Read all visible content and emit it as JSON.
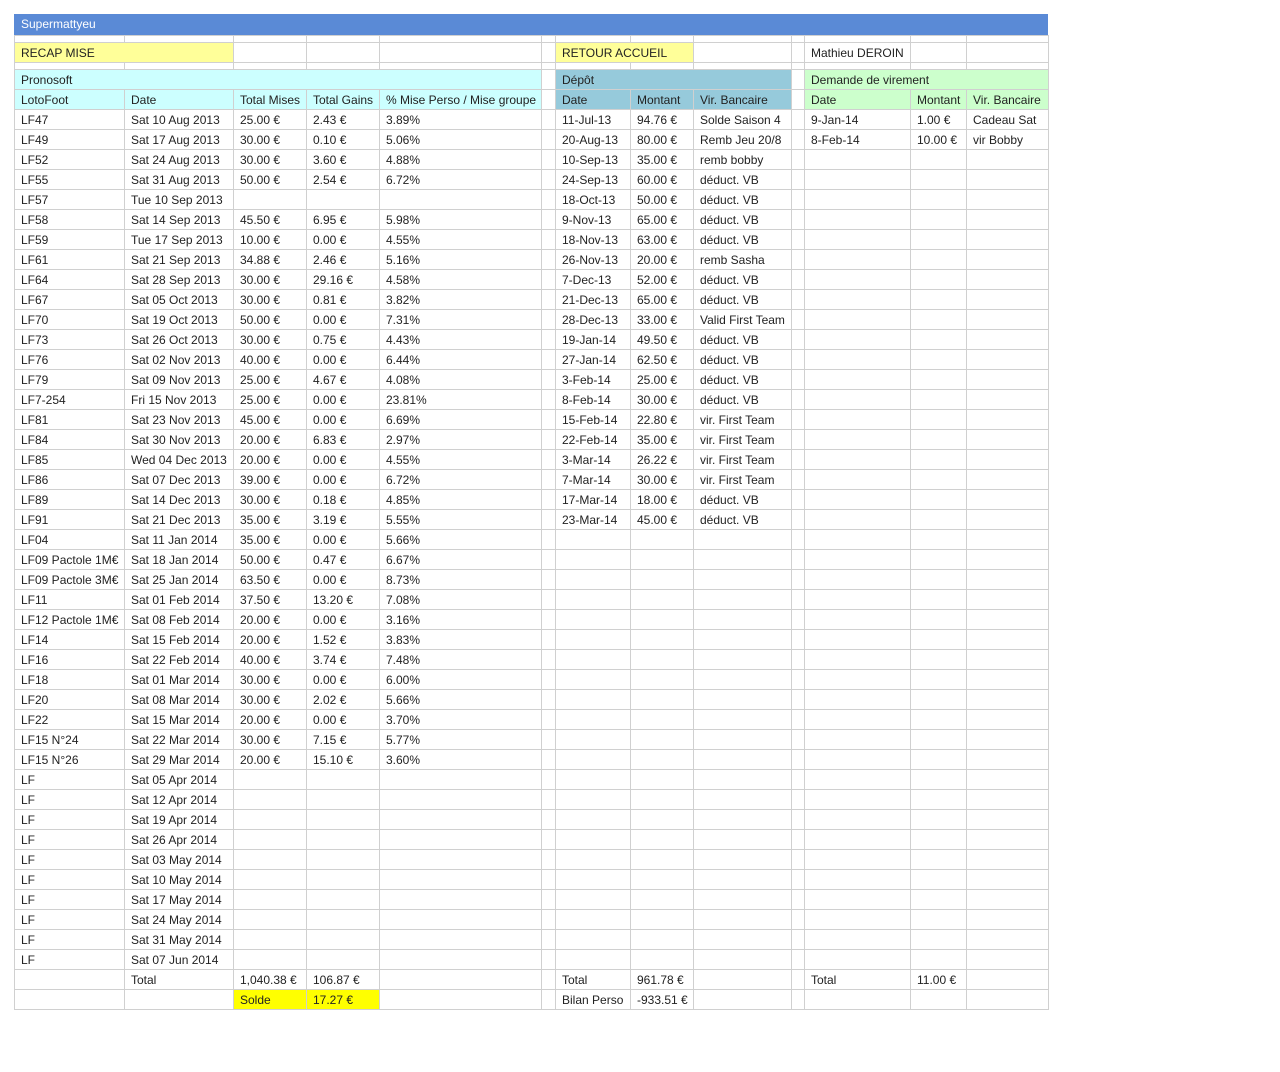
{
  "sheet_title": "Supermattyeu",
  "top": {
    "recap_button": "RECAP MISE",
    "home_button": "RETOUR ACCUEIL",
    "user_name": "Mathieu DEROIN"
  },
  "sections": {
    "pronosoft": "Pronosoft",
    "depot": "Dépôt",
    "virement": "Demande de virement"
  },
  "colors": {
    "title_bar": "#5a8ad6",
    "yellow_cell": "#ffff99",
    "cyan_header": "#ccffff",
    "blue_header": "#96cadb",
    "green_header": "#ccffcc",
    "highlight": "#ffff00"
  },
  "headers": {
    "lotofoot": "LotoFoot",
    "date": "Date",
    "total_mises": "Total Mises",
    "total_gains": "Total Gains",
    "pct": "% Mise Perso / Mise groupe",
    "dep_date": "Date",
    "dep_montant": "Montant",
    "dep_vir": "Vir. Bancaire",
    "vir_date": "Date",
    "vir_montant": "Montant",
    "vir_vir": "Vir. Bancaire"
  },
  "pronos": [
    {
      "lf": "LF47",
      "date": "Sat 10 Aug 2013",
      "mises": "25.00 €",
      "gains": "2.43 €",
      "pct": "3.89%"
    },
    {
      "lf": "LF49",
      "date": "Sat 17 Aug 2013",
      "mises": "30.00 €",
      "gains": "0.10 €",
      "pct": "5.06%"
    },
    {
      "lf": "LF52",
      "date": "Sat 24 Aug 2013",
      "mises": "30.00 €",
      "gains": "3.60 €",
      "pct": "4.88%"
    },
    {
      "lf": "LF55",
      "date": "Sat 31 Aug 2013",
      "mises": "50.00 €",
      "gains": "2.54 €",
      "pct": "6.72%"
    },
    {
      "lf": "LF57",
      "date": "Tue 10 Sep 2013",
      "mises": "",
      "gains": "",
      "pct": ""
    },
    {
      "lf": "LF58",
      "date": "Sat 14 Sep 2013",
      "mises": "45.50 €",
      "gains": "6.95 €",
      "pct": "5.98%"
    },
    {
      "lf": "LF59",
      "date": "Tue 17 Sep 2013",
      "mises": "10.00 €",
      "gains": "0.00 €",
      "pct": "4.55%"
    },
    {
      "lf": "LF61",
      "date": "Sat 21 Sep 2013",
      "mises": "34.88 €",
      "gains": "2.46 €",
      "pct": "5.16%"
    },
    {
      "lf": "LF64",
      "date": "Sat 28 Sep 2013",
      "mises": "30.00 €",
      "gains": "29.16 €",
      "pct": "4.58%"
    },
    {
      "lf": "LF67",
      "date": "Sat 05 Oct 2013",
      "mises": "30.00 €",
      "gains": "0.81 €",
      "pct": "3.82%"
    },
    {
      "lf": "LF70",
      "date": "Sat 19 Oct 2013",
      "mises": "50.00 €",
      "gains": "0.00 €",
      "pct": "7.31%"
    },
    {
      "lf": "LF73",
      "date": "Sat 26 Oct 2013",
      "mises": "30.00 €",
      "gains": "0.75 €",
      "pct": "4.43%"
    },
    {
      "lf": "LF76",
      "date": "Sat 02 Nov 2013",
      "mises": "40.00 €",
      "gains": "0.00 €",
      "pct": "6.44%"
    },
    {
      "lf": "LF79",
      "date": "Sat 09 Nov 2013",
      "mises": "25.00 €",
      "gains": "4.67 €",
      "pct": "4.08%"
    },
    {
      "lf": "LF7-254",
      "date": "Fri 15 Nov 2013",
      "mises": "25.00 €",
      "gains": "0.00 €",
      "pct": "23.81%"
    },
    {
      "lf": "LF81",
      "date": "Sat 23 Nov 2013",
      "mises": "45.00 €",
      "gains": "0.00 €",
      "pct": "6.69%"
    },
    {
      "lf": "LF84",
      "date": "Sat 30 Nov 2013",
      "mises": "20.00 €",
      "gains": "6.83 €",
      "pct": "2.97%"
    },
    {
      "lf": "LF85",
      "date": "Wed 04 Dec 2013",
      "mises": "20.00 €",
      "gains": "0.00 €",
      "pct": "4.55%"
    },
    {
      "lf": "LF86",
      "date": "Sat 07 Dec 2013",
      "mises": "39.00 €",
      "gains": "0.00 €",
      "pct": "6.72%"
    },
    {
      "lf": "LF89",
      "date": "Sat 14 Dec 2013",
      "mises": "30.00 €",
      "gains": "0.18 €",
      "pct": "4.85%"
    },
    {
      "lf": "LF91",
      "date": "Sat 21 Dec 2013",
      "mises": "35.00 €",
      "gains": "3.19 €",
      "pct": "5.55%"
    },
    {
      "lf": "LF04",
      "date": "Sat 11 Jan 2014",
      "mises": "35.00 €",
      "gains": "0.00 €",
      "pct": "5.66%"
    },
    {
      "lf": "LF09 Pactole 1M€",
      "date": "Sat 18 Jan 2014",
      "mises": "50.00 €",
      "gains": "0.47 €",
      "pct": "6.67%"
    },
    {
      "lf": "LF09 Pactole 3M€",
      "date": "Sat 25 Jan 2014",
      "mises": "63.50 €",
      "gains": "0.00 €",
      "pct": "8.73%"
    },
    {
      "lf": "LF11",
      "date": "Sat 01 Feb 2014",
      "mises": "37.50 €",
      "gains": "13.20 €",
      "pct": "7.08%"
    },
    {
      "lf": "LF12 Pactole 1M€",
      "date": "Sat 08 Feb 2014",
      "mises": "20.00 €",
      "gains": "0.00 €",
      "pct": "3.16%"
    },
    {
      "lf": "LF14",
      "date": "Sat 15 Feb 2014",
      "mises": "20.00 €",
      "gains": "1.52 €",
      "pct": "3.83%"
    },
    {
      "lf": "LF16",
      "date": "Sat 22 Feb 2014",
      "mises": "40.00 €",
      "gains": "3.74 €",
      "pct": "7.48%"
    },
    {
      "lf": "LF18",
      "date": "Sat 01 Mar 2014",
      "mises": "30.00 €",
      "gains": "0.00 €",
      "pct": "6.00%"
    },
    {
      "lf": "LF20",
      "date": "Sat 08 Mar 2014",
      "mises": "30.00 €",
      "gains": "2.02 €",
      "pct": "5.66%"
    },
    {
      "lf": "LF22",
      "date": "Sat 15 Mar 2014",
      "mises": "20.00 €",
      "gains": "0.00 €",
      "pct": "3.70%"
    },
    {
      "lf": "LF15 N°24",
      "date": "Sat 22 Mar 2014",
      "mises": "30.00 €",
      "gains": "7.15 €",
      "pct": "5.77%"
    },
    {
      "lf": "LF15 N°26",
      "date": "Sat 29 Mar 2014",
      "mises": "20.00 €",
      "gains": "15.10 €",
      "pct": "3.60%"
    },
    {
      "lf": "LF",
      "date": "Sat 05 Apr 2014",
      "mises": "",
      "gains": "",
      "pct": ""
    },
    {
      "lf": "LF",
      "date": "Sat 12 Apr 2014",
      "mises": "",
      "gains": "",
      "pct": ""
    },
    {
      "lf": "LF",
      "date": "Sat 19 Apr 2014",
      "mises": "",
      "gains": "",
      "pct": ""
    },
    {
      "lf": "LF",
      "date": "Sat 26 Apr 2014",
      "mises": "",
      "gains": "",
      "pct": ""
    },
    {
      "lf": "LF",
      "date": "Sat 03 May 2014",
      "mises": "",
      "gains": "",
      "pct": ""
    },
    {
      "lf": "LF",
      "date": "Sat 10 May 2014",
      "mises": "",
      "gains": "",
      "pct": ""
    },
    {
      "lf": "LF",
      "date": "Sat 17 May 2014",
      "mises": "",
      "gains": "",
      "pct": ""
    },
    {
      "lf": "LF",
      "date": "Sat 24 May 2014",
      "mises": "",
      "gains": "",
      "pct": ""
    },
    {
      "lf": "LF",
      "date": "Sat 31 May 2014",
      "mises": "",
      "gains": "",
      "pct": ""
    },
    {
      "lf": "LF",
      "date": "Sat 07 Jun 2014",
      "mises": "",
      "gains": "",
      "pct": ""
    }
  ],
  "depots": [
    {
      "date": "11-Jul-13",
      "montant": "94.76 €",
      "vir": "Solde Saison 4"
    },
    {
      "date": "20-Aug-13",
      "montant": "80.00 €",
      "vir": "Remb Jeu 20/8"
    },
    {
      "date": "10-Sep-13",
      "montant": "35.00 €",
      "vir": "remb bobby"
    },
    {
      "date": "24-Sep-13",
      "montant": "60.00 €",
      "vir": "déduct. VB"
    },
    {
      "date": "18-Oct-13",
      "montant": "50.00 €",
      "vir": "déduct. VB"
    },
    {
      "date": "9-Nov-13",
      "montant": "65.00 €",
      "vir": "déduct. VB"
    },
    {
      "date": "18-Nov-13",
      "montant": "63.00 €",
      "vir": "déduct. VB"
    },
    {
      "date": "26-Nov-13",
      "montant": "20.00 €",
      "vir": "remb Sasha"
    },
    {
      "date": "7-Dec-13",
      "montant": "52.00 €",
      "vir": "déduct. VB"
    },
    {
      "date": "21-Dec-13",
      "montant": "65.00 €",
      "vir": "déduct. VB"
    },
    {
      "date": "28-Dec-13",
      "montant": "33.00 €",
      "vir": "Valid First Team"
    },
    {
      "date": "19-Jan-14",
      "montant": "49.50 €",
      "vir": "déduct. VB"
    },
    {
      "date": "27-Jan-14",
      "montant": "62.50 €",
      "vir": "déduct. VB"
    },
    {
      "date": "3-Feb-14",
      "montant": "25.00 €",
      "vir": "déduct. VB"
    },
    {
      "date": "8-Feb-14",
      "montant": "30.00 €",
      "vir": "déduct. VB"
    },
    {
      "date": "15-Feb-14",
      "montant": "22.80 €",
      "vir": "vir. First Team"
    },
    {
      "date": "22-Feb-14",
      "montant": "35.00 €",
      "vir": "vir. First Team"
    },
    {
      "date": "3-Mar-14",
      "montant": "26.22 €",
      "vir": "vir. First Team"
    },
    {
      "date": "7-Mar-14",
      "montant": "30.00 €",
      "vir": "vir. First Team"
    },
    {
      "date": "17-Mar-14",
      "montant": "18.00 €",
      "vir": "déduct. VB"
    },
    {
      "date": "23-Mar-14",
      "montant": "45.00 €",
      "vir": "déduct. VB"
    }
  ],
  "virements": [
    {
      "date": "9-Jan-14",
      "montant": "1.00 €",
      "vir": "Cadeau Sat"
    },
    {
      "date": "8-Feb-14",
      "montant": "10.00 €",
      "vir": "vir Bobby"
    }
  ],
  "totals": {
    "label": "Total",
    "mises": "1,040.38 €",
    "gains": "106.87 €",
    "solde_label": "Solde",
    "solde_value": "17.27 €",
    "depot_label": "Total",
    "depot_total": "961.78 €",
    "bilan_label": "Bilan Perso",
    "bilan_value": "-933.51 €",
    "vir_label": "Total",
    "vir_total": "11.00 €"
  }
}
